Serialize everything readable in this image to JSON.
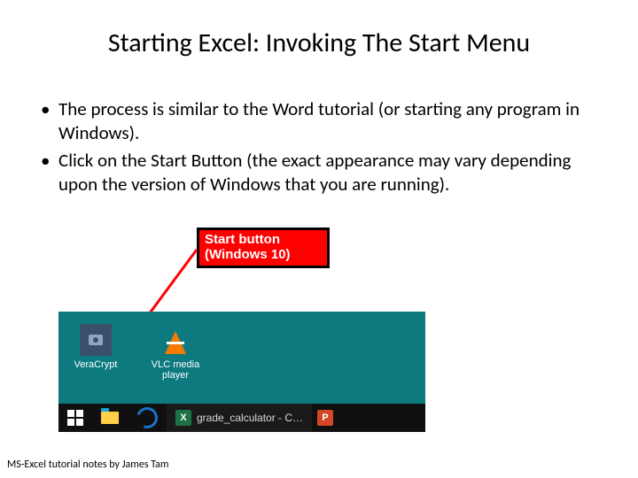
{
  "title": "Starting Excel: Invoking The Start Menu",
  "bullets": [
    "The process is similar to the Word tutorial (or starting any program in Windows).",
    "Click on the Start Button (the exact appearance may vary depending upon the version of Windows that you are running)."
  ],
  "callout": {
    "line1": "Start button",
    "line2": "(Windows 10)"
  },
  "desktop": {
    "veracrypt_label": "VeraCrypt",
    "vlc_label_line1": "VLC media",
    "vlc_label_line2": "player"
  },
  "taskbar": {
    "excel_task_label": "grade_calculator - C…"
  },
  "footer": "MS-Excel tutorial notes by James Tam"
}
